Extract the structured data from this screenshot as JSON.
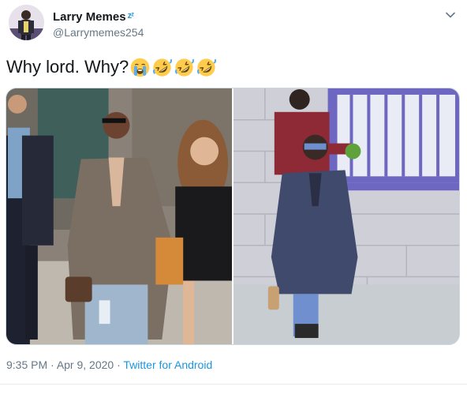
{
  "user": {
    "display_name": "Larry Memes",
    "name_decoration": "zᶻ",
    "handle": "@Larrymemes254"
  },
  "tweet": {
    "text": "Why lord. Why?",
    "emojis": [
      "loudly-crying-face",
      "rolling-on-floor-laughing",
      "rolling-on-floor-laughing",
      "rolling-on-floor-laughing"
    ]
  },
  "media": {
    "photo_count": 2
  },
  "meta": {
    "time": "9:35 PM",
    "sep1": " · ",
    "date": "Apr 9, 2020",
    "sep2": " · ",
    "source": "Twitter for Android"
  },
  "colors": {
    "text": "#14171a",
    "secondary": "#657786",
    "link": "#1b95e0",
    "border": "#ccd6dd"
  }
}
